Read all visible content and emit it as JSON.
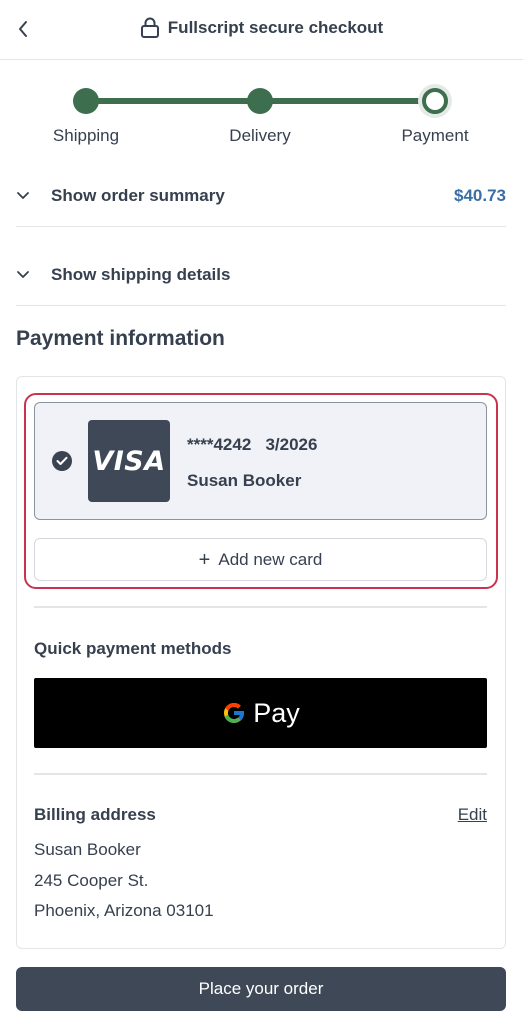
{
  "header": {
    "title": "Fullscript secure checkout",
    "back_icon": "chevron-left-icon",
    "lock_icon": "lock-icon"
  },
  "stepper": {
    "steps": [
      {
        "label": "Shipping",
        "state": "complete"
      },
      {
        "label": "Delivery",
        "state": "complete"
      },
      {
        "label": "Payment",
        "state": "current"
      }
    ],
    "accent_color": "#3d6e4e"
  },
  "order_summary": {
    "label": "Show order summary",
    "amount": "$40.73"
  },
  "shipping_details": {
    "label": "Show shipping details"
  },
  "payment": {
    "title": "Payment information",
    "card": {
      "brand": "VISA",
      "number": "****4242",
      "expiry": "3/2026",
      "holder": "Susan Booker",
      "selected": true
    },
    "add_card_label": "Add new card",
    "highlight_color": "#c8334f"
  },
  "quick_payment": {
    "title": "Quick payment methods",
    "gpay_label": "Pay"
  },
  "billing": {
    "title": "Billing address",
    "edit_label": "Edit",
    "name": "Susan Booker",
    "street": "245 Cooper St.",
    "city_line": "Phoenix, Arizona 03101"
  },
  "place_order_label": "Place your order"
}
